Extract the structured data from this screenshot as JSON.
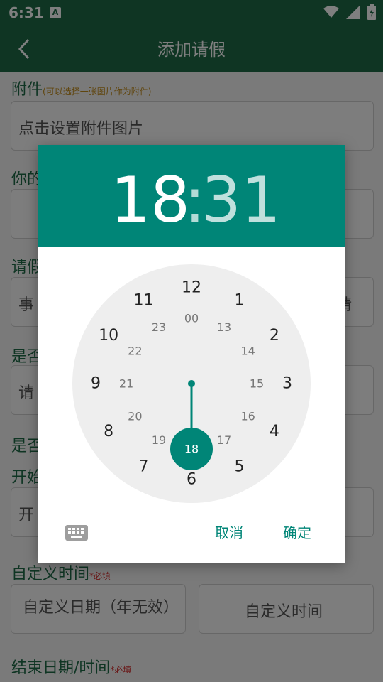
{
  "status_bar": {
    "time": "6:31",
    "notification_icon": "A",
    "icons": [
      "wifi-icon",
      "signal-icon",
      "battery-icon"
    ]
  },
  "app_bar": {
    "title": "添加请假"
  },
  "form": {
    "attachment_label": "附件",
    "attachment_hint": "(可以选择一张图片作为附件)",
    "attachment_placeholder": "点击设置附件图片",
    "second_label": "你的",
    "leave_type_label": "请假",
    "leave_type_left": "事",
    "leave_type_right": "请",
    "is_label_1": "是否",
    "is_value_1": "请",
    "is_label_2": "是否",
    "start_label": "开始",
    "start_value": "开",
    "custom_time_label": "自定义时间",
    "custom_time_req": "*必填",
    "custom_date_button": "自定义日期（年无效）",
    "custom_time_button": "自定义时间",
    "end_label": "结束日期/时间",
    "end_req": "*必填"
  },
  "time_picker": {
    "hour": "18",
    "separator": ":",
    "minute": "31",
    "selected_hour": "18",
    "outer_hours": [
      "12",
      "1",
      "2",
      "3",
      "4",
      "5",
      "6",
      "7",
      "8",
      "9",
      "10",
      "11"
    ],
    "inner_hours": [
      "00",
      "13",
      "14",
      "15",
      "16",
      "17",
      "18",
      "19",
      "20",
      "21",
      "22",
      "23"
    ],
    "cancel_label": "取消",
    "ok_label": "确定",
    "colors": {
      "accent": "#008577",
      "dial": "#eeeeee",
      "app_bar": "#1e6a47"
    }
  }
}
